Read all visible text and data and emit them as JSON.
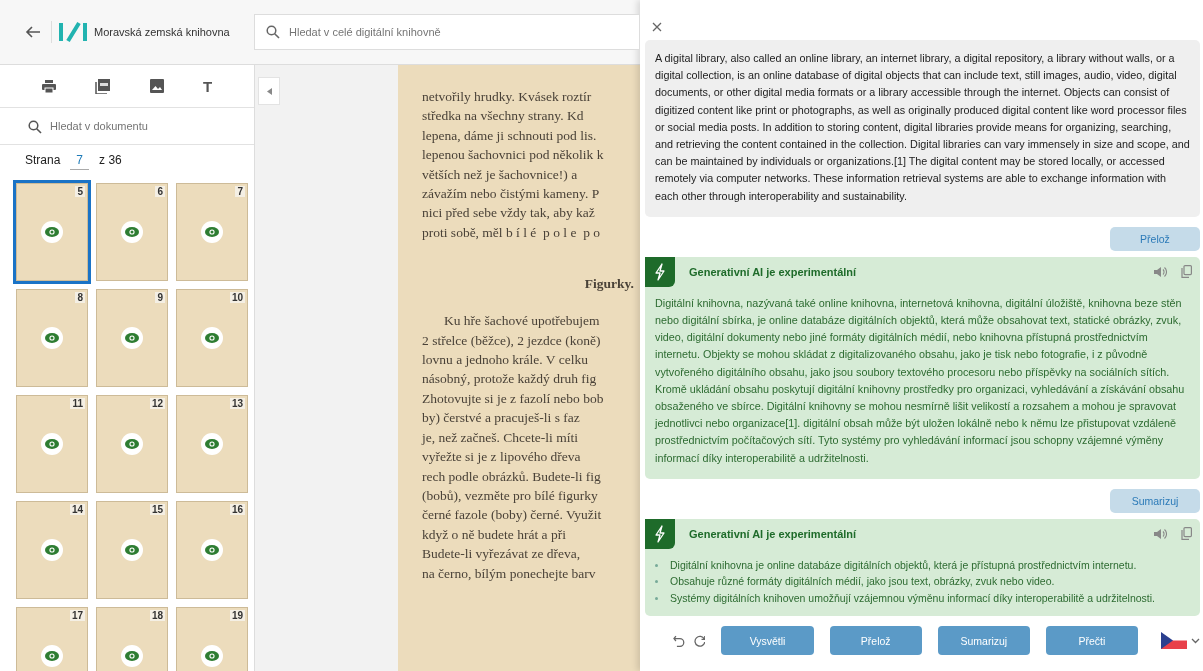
{
  "header": {
    "logo_text": "Moravská zemská knihovna",
    "search": {
      "placeholder": "Hledat v celé digitální knihovně"
    }
  },
  "sidebar": {
    "text_tool_glyph": "T",
    "doc_search": {
      "placeholder": "Hledat v dokumentu"
    },
    "pager": {
      "label": "Strana",
      "page": "7",
      "total": "z 36"
    },
    "thumbnails": [
      {
        "number": "5",
        "selected": true
      },
      {
        "number": "6",
        "selected": false
      },
      {
        "number": "7",
        "selected": false
      },
      {
        "number": "8",
        "selected": false
      },
      {
        "number": "9",
        "selected": false
      },
      {
        "number": "10",
        "selected": false
      },
      {
        "number": "11",
        "selected": false
      },
      {
        "number": "12",
        "selected": false
      },
      {
        "number": "13",
        "selected": false
      },
      {
        "number": "14",
        "selected": false
      },
      {
        "number": "15",
        "selected": false
      },
      {
        "number": "16",
        "selected": false
      },
      {
        "number": "17",
        "selected": false
      },
      {
        "number": "18",
        "selected": false
      },
      {
        "number": "19",
        "selected": false
      }
    ]
  },
  "viewer": {
    "page": {
      "lines_top": [
        "netvořily hrudky. Kvásek roztír",
        "středka na všechny strany. Kd",
        "lepena, dáme ji schnouti pod lis.",
        "lepenou šachovnici pod několik k",
        "větších než je šachovnice!) a",
        "závažím nebo čistými kameny. P",
        "nici před sebe vždy tak, aby kaž",
        "proti sobě, měl b í l é  p o l e  p o"
      ],
      "heading": "Figurky.",
      "lines_bottom": [
        "Ku hře šachové upotřebujem",
        "2 střelce (běžce), 2 jezdce (koně)",
        "lovnu a jednoho krále. V celku",
        "násobný, protože každý druh fig",
        "Zhotovujte si je z fazolí nebo bob",
        "by) čerstvé a pracuješ-li s faz",
        "je, než začneš. Chcete-li míti",
        "vyřežte si je z lipového dřeva",
        "rech podle obrázků. Budete-li fig",
        "(bobů), vezměte pro bílé figurky",
        "černé fazole (boby) černé. Využit",
        "když o ně budete hrát a při",
        "Budete-li vyřezávat ze dřeva,",
        "na černo, bílým ponechejte barv"
      ]
    }
  },
  "assistant": {
    "source_text": "A digital library, also called an online library, an internet library, a digital repository, a library without walls, or a digital collection, is an online database of digital objects that can include text, still images, audio, video, digital documents, or other digital media formats or a library accessible through the internet. Objects can consist of digitized content like print or photographs, as well as originally produced digital content like word processor files or social media posts. In addition to storing content, digital libraries provide means for organizing, searching, and retrieving the content contained in the collection. Digital libraries can vary immensely in size and scope, and can be maintained by individuals or organizations.[1] The digital content may be stored locally, or accessed remotely via computer networks. These information retrieval systems are able to exchange information with each other through interoperability and sustainability.",
    "exchanges": [
      {
        "request": "Přelož",
        "response": {
          "title": "Generativní AI je experimentální",
          "kind": "paragraph",
          "text": "Digitální knihovna, nazývaná také online knihovna, internetová knihovna, digitální úložiště, knihovna beze stěn nebo digitální sbírka, je online databáze digitálních objektů, která může obsahovat text, statické obrázky, zvuk, video, digitální dokumenty nebo jiné formáty digitálních médií, nebo knihovna přístupná prostřednictvím internetu. Objekty se mohou skládat z digitalizovaného obsahu, jako je tisk nebo fotografie, i z původně vytvořeného digitálního obsahu, jako jsou soubory textového procesoru nebo příspěvky na sociálních sítích. Kromě ukládání obsahu poskytují digitální knihovny prostředky pro organizaci, vyhledávání a získávání obsahu obsaženého ve sbírce. Digitální knihovny se mohou nesmírně lišit velikostí a rozsahem a mohou je spravovat jednotlivci nebo organizace[1]. digitální obsah může být uložen lokálně nebo k němu lze přistupovat vzdáleně prostřednictvím počítačových sítí. Tyto systémy pro vyhledávání informací jsou schopny vzájemné výměny informací díky interoperabilitě a udržitelnosti."
        }
      },
      {
        "request": "Sumarizuj",
        "response": {
          "title": "Generativní AI je experimentální",
          "kind": "bullets",
          "bullets": [
            "Digitální knihovna je online databáze digitálních objektů, která je přístupná prostřednictvím internetu.",
            "Obsahuje různé formáty digitálních médií, jako jsou text, obrázky, zvuk nebo video.",
            "Systémy digitálních knihoven umožňují vzájemnou výměnu informací díky interoperabilitě a udržitelnosti."
          ]
        }
      }
    ],
    "actions": [
      "Vysvětli",
      "Přelož",
      "Sumarizuj",
      "Přečti"
    ]
  }
}
